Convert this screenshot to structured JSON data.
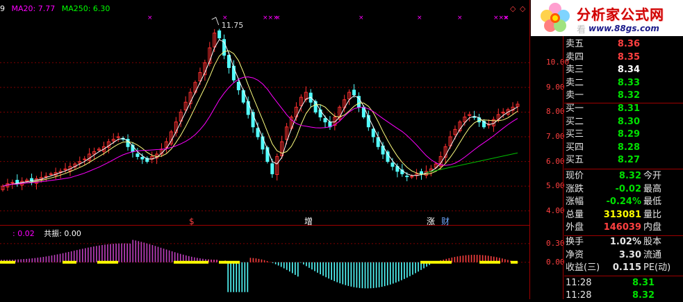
{
  "header": {
    "first_digit": "9",
    "ma20": "MA20: 7.77",
    "ma250": "MA250: 6.30",
    "osc_value": ": 0.02",
    "resonance": "共振: 0.00"
  },
  "chart_data": {
    "type": "candlestick",
    "ylim": [
      3.6,
      12.2
    ],
    "yticks": [
      "10.00",
      "9.00",
      "8.00",
      "7.00",
      "6.00",
      "5.00",
      "4.00"
    ],
    "ytick_values": [
      10,
      9,
      8,
      7,
      6,
      5,
      4
    ],
    "peak_label": "11.75",
    "peak_value": 11.75,
    "event_markers": [
      {
        "label": "$",
        "color": "#ff4040"
      },
      {
        "label": "增",
        "color": "#ffffff"
      },
      {
        "label": "涨",
        "color": "#ffffff"
      },
      {
        "label": "财",
        "color": "#6fa8ff"
      }
    ],
    "sub_yticks": [
      "0.30",
      "0.00"
    ],
    "sub_ytick_values": [
      0.3,
      0.0
    ],
    "sub_ylim": [
      -0.55,
      0.5
    ],
    "closes": [
      5.0,
      5.1,
      5.15,
      5.1,
      5.2,
      5.25,
      5.2,
      5.3,
      5.35,
      5.4,
      5.5,
      5.55,
      5.6,
      5.7,
      5.8,
      5.9,
      6.0,
      6.1,
      6.3,
      6.4,
      6.5,
      6.6,
      6.8,
      6.9,
      7.0,
      6.9,
      6.6,
      6.4,
      6.2,
      6.1,
      6.0,
      6.2,
      6.3,
      6.5,
      6.8,
      7.2,
      7.6,
      8.0,
      8.4,
      8.8,
      9.2,
      9.6,
      10.0,
      10.6,
      11.2,
      11.0,
      10.3,
      9.8,
      9.3,
      8.9,
      8.4,
      7.9,
      7.4,
      7.0,
      6.5,
      6.0,
      5.5,
      6.2,
      6.8,
      7.4,
      7.8,
      8.2,
      8.6,
      8.8,
      8.4,
      8.0,
      7.8,
      7.6,
      7.4,
      7.8,
      8.2,
      8.5,
      8.8,
      8.7,
      8.2,
      7.8,
      7.4,
      7.0,
      6.6,
      6.3,
      6.0,
      5.8,
      5.6,
      5.5,
      5.4,
      5.4,
      5.5,
      5.5,
      5.6,
      5.7,
      5.9,
      6.2,
      6.6,
      7.0,
      7.3,
      7.6,
      7.8,
      7.9,
      7.8,
      7.6,
      7.4,
      7.5,
      7.7,
      7.9,
      8.0,
      8.1,
      8.2,
      8.32
    ]
  },
  "quote": {
    "rows": [
      {
        "label": "卖五",
        "value": "8.36",
        "color": "#ff4040"
      },
      {
        "label": "卖四",
        "value": "8.35",
        "color": "#ff4040"
      },
      {
        "label": "卖三",
        "value": "8.34",
        "color": "#ffffff"
      },
      {
        "label": "卖二",
        "value": "8.33",
        "color": "#00e000"
      },
      {
        "label": "卖一",
        "value": "8.32",
        "color": "#00e000"
      },
      {
        "label": "买一",
        "value": "8.31",
        "color": "#00e000"
      },
      {
        "label": "买二",
        "value": "8.30",
        "color": "#00e000"
      },
      {
        "label": "买三",
        "value": "8.29",
        "color": "#00e000"
      },
      {
        "label": "买四",
        "value": "8.28",
        "color": "#00e000"
      },
      {
        "label": "买五",
        "value": "8.27",
        "color": "#00e000"
      }
    ],
    "stats": [
      {
        "label": "现价",
        "value": "8.32",
        "color": "#00e000",
        "label2": "今开"
      },
      {
        "label": "涨跌",
        "value": "-0.02",
        "color": "#00e000",
        "label2": "最高"
      },
      {
        "label": "涨幅",
        "value": "-0.24%",
        "color": "#00e000",
        "label2": "最低"
      },
      {
        "label": "总量",
        "value": "313081",
        "color": "#ffff00",
        "label2": "量比"
      },
      {
        "label": "外盘",
        "value": "146039",
        "color": "#ff4040",
        "label2": "内盘"
      },
      {
        "label": "换手",
        "value": "1.02%",
        "color": "#e6e6e6",
        "label2": "股本"
      },
      {
        "label": "净资",
        "value": "3.30",
        "color": "#e6e6e6",
        "label2": "流通"
      },
      {
        "label": "收益(三)",
        "value": "0.115",
        "color": "#e6e6e6",
        "label2": "PE(动)"
      }
    ],
    "ticks": [
      {
        "time": "11:28",
        "price": "8.31",
        "color": "#00e000"
      },
      {
        "time": "11:28",
        "price": "8.32",
        "color": "#00e000"
      }
    ]
  },
  "logo": {
    "title": "分析家公式网",
    "url": "www.88gs.com",
    "behind_text": "看  中   看看"
  },
  "colors": {
    "up": "#ff3030",
    "down": "#54ffff",
    "ma_short": "#ffffff",
    "ma_mid": "#ffff80",
    "ma20": "#ff00ff",
    "ma250": "#00c000",
    "grid": "#800000",
    "frame": "#a00000"
  }
}
